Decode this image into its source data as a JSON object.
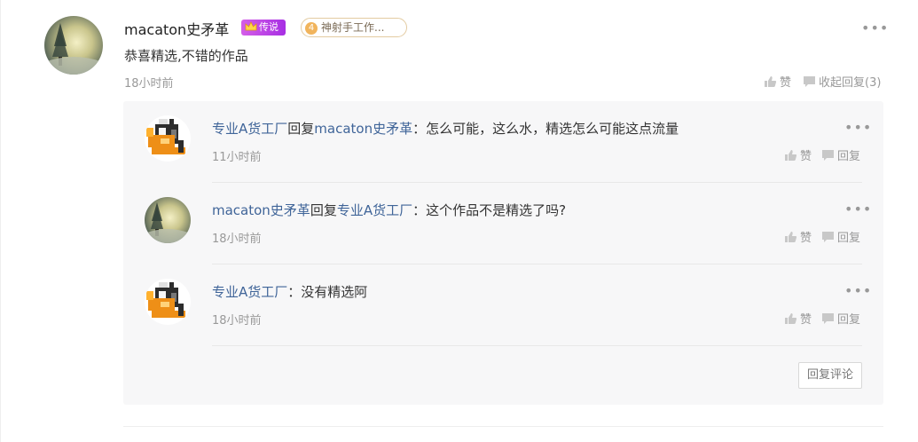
{
  "comment": {
    "username": "macaton史矛革",
    "badge_legend": "传说",
    "badge_level_num": "4",
    "badge_level_text": "神射手工作...",
    "text": "恭喜精选,不错的作品",
    "time": "18小时前",
    "more": "•••",
    "like_label": "赞",
    "collapse_label": "收起回复(3)"
  },
  "replies": [
    {
      "author": "专业A货工厂",
      "reply_word": "回复",
      "target": "macaton史矛革",
      "separator": "：",
      "text": "怎么可能，这么水，精选怎么可能这点流量",
      "time": "11小时前",
      "avatar_icon": "robot-avatar-icon",
      "like_label": "赞",
      "reply_label": "回复",
      "more": "•••"
    },
    {
      "author": "macaton史矛革",
      "reply_word": "回复",
      "target": "专业A货工厂",
      "separator": "：",
      "text": "这个作品不是精选了吗?",
      "time": "18小时前",
      "avatar_icon": "winter-scene-avatar-icon",
      "like_label": "赞",
      "reply_label": "回复",
      "more": "•••"
    },
    {
      "author": "专业A货工厂",
      "separator": "：",
      "text": "没有精选阿",
      "time": "18小时前",
      "avatar_icon": "robot-avatar-icon",
      "like_label": "赞",
      "reply_label": "回复",
      "more": "•••"
    }
  ],
  "reply_comment_button": "回复评论",
  "colors": {
    "link": "#406599",
    "badge_legend": "#b63be6",
    "level_circle": "#f1b45c",
    "reply_bg": "#f7f7f8"
  }
}
